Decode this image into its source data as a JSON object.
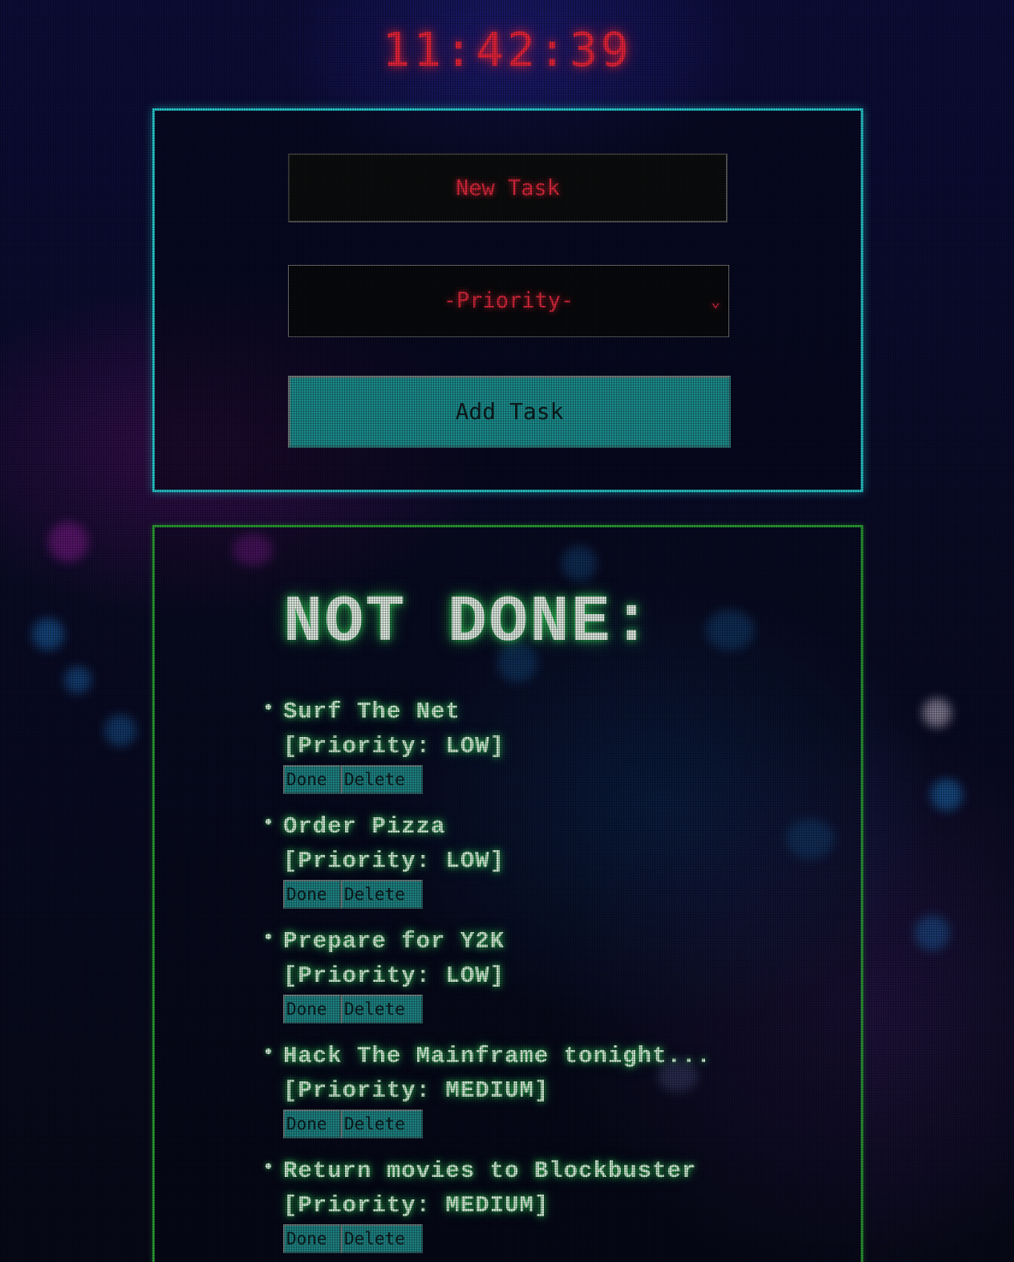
{
  "clock": {
    "time": "11:42:39"
  },
  "form": {
    "task_placeholder": "New Task",
    "priority_selected": "-Priority-",
    "add_button_label": "Add Task"
  },
  "not_done": {
    "title": "NOT DONE:",
    "priority_prefix": "[Priority: ",
    "priority_suffix": "]",
    "done_label": "Done",
    "delete_label": "Delete",
    "tasks": [
      {
        "name": "Surf The Net",
        "priority": "[Priority: LOW]"
      },
      {
        "name": "Order Pizza",
        "priority": "[Priority: LOW]"
      },
      {
        "name": "Prepare for Y2K",
        "priority": "[Priority: LOW]"
      },
      {
        "name": "Hack The Mainframe tonight...",
        "priority": "[Priority: MEDIUM]"
      },
      {
        "name": "Return movies to Blockbuster",
        "priority": "[Priority: MEDIUM]"
      }
    ]
  },
  "colors": {
    "form_border": "#27c8cc",
    "list_border": "#2a9a32",
    "clock_red": "#e3233b",
    "button_teal": "#1b8a8b",
    "text_green_glow": "#c6e4cc"
  },
  "icons": {
    "priority_dropdown": "chevron-down-icon",
    "list_bullet": "bullet-dot"
  }
}
